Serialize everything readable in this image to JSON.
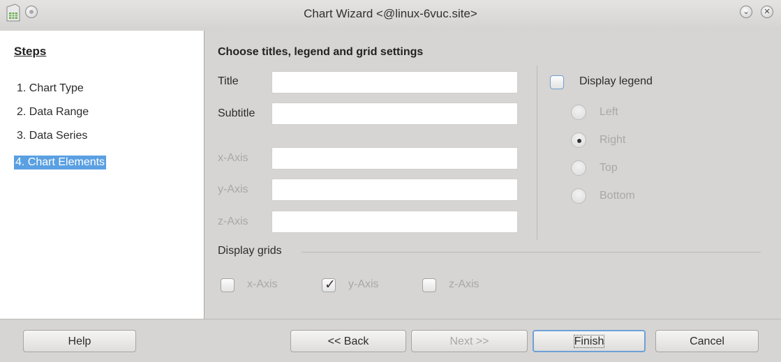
{
  "window": {
    "title": "Chart Wizard <@linux-6vuc.site>"
  },
  "steps": {
    "heading": "Steps",
    "items": [
      {
        "label": "1. Chart Type"
      },
      {
        "label": "2. Data Range"
      },
      {
        "label": "3. Data Series"
      },
      {
        "label": "4. Chart Elements"
      }
    ]
  },
  "page": {
    "heading": "Choose titles, legend and grid settings",
    "fields": {
      "title": {
        "label": "Title",
        "value": ""
      },
      "subtitle": {
        "label": "Subtitle",
        "value": ""
      },
      "x_axis": {
        "label": "x-Axis",
        "value": ""
      },
      "y_axis": {
        "label": "y-Axis",
        "value": ""
      },
      "z_axis": {
        "label": "z-Axis",
        "value": ""
      }
    },
    "legend": {
      "display_label": "Display legend",
      "checked": false,
      "options": [
        "Left",
        "Right",
        "Top",
        "Bottom"
      ],
      "selected": "Right"
    },
    "grids": {
      "label": "Display grids",
      "x_axis": "x-Axis",
      "y_axis": "y-Axis",
      "z_axis": "z-Axis",
      "y_checked": true
    }
  },
  "buttons": {
    "help": "Help",
    "back": "<< Back",
    "next": "Next >>",
    "finish": "Finish",
    "cancel": "Cancel"
  },
  "colors": {
    "selection": "#5aa0e2",
    "focus": "#6ea0d6"
  }
}
